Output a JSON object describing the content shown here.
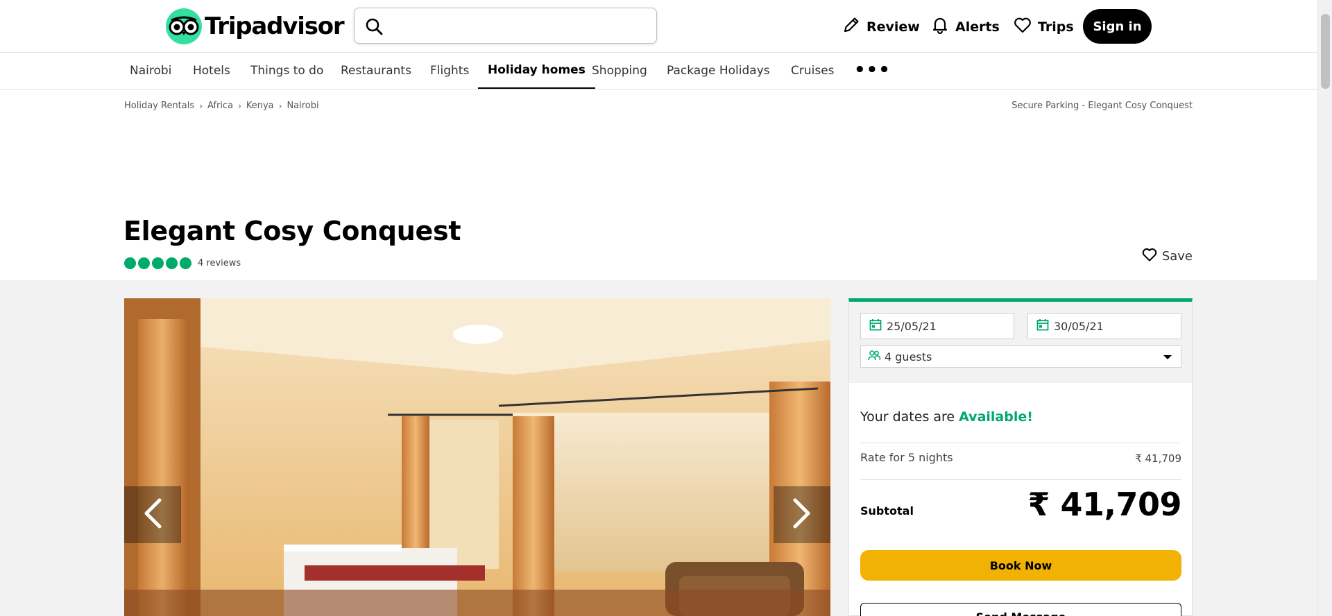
{
  "header": {
    "brand": "Tripadvisor",
    "search": {
      "placeholder": "",
      "value": ""
    },
    "actions": [
      {
        "label": "Review",
        "icon": "pencil-icon"
      },
      {
        "label": "Alerts",
        "icon": "bell-icon"
      },
      {
        "label": "Trips",
        "icon": "heart-icon"
      }
    ],
    "signin_label": "Sign in"
  },
  "nav": {
    "tabs": [
      "Nairobi",
      "Hotels",
      "Things to do",
      "Restaurants",
      "Flights",
      "Holiday homes",
      "Shopping",
      "Package Holidays",
      "Cruises"
    ],
    "active_tab": "Holiday homes",
    "more": "•••"
  },
  "breadcrumb": {
    "items": [
      "Holiday Rentals",
      "Africa",
      "Kenya",
      "Nairobi"
    ],
    "right": "Secure Parking - Elegant Cosy Conquest"
  },
  "listing": {
    "title": "Elegant Cosy Conquest",
    "rating_bubbles": 5,
    "reviews": "4 reviews",
    "save_label": "Save"
  },
  "booking": {
    "checkin": "25/05/21",
    "checkout": "30/05/21",
    "guests": "4 guests",
    "availability_prefix": "Your dates are",
    "availability_status": "Available!",
    "rate_label": "Rate for 5 nights",
    "rate_amount": "₹ 41,709",
    "subtotal_label": "Subtotal",
    "subtotal_amount": "₹ 41,709",
    "book_label": "Book Now",
    "message_label": "Send Message"
  },
  "colors": {
    "brand_green": "#34e0a1",
    "rating_green": "#00aa6c",
    "book_yellow": "#f2b203"
  }
}
